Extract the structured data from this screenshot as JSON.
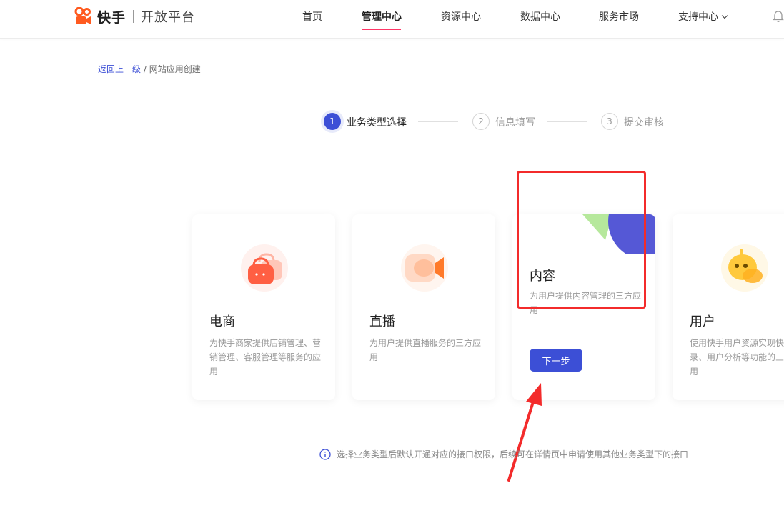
{
  "header": {
    "brand": "快手",
    "subtitle": "开放平台",
    "nav": [
      {
        "label": "首页",
        "active": false
      },
      {
        "label": "管理中心",
        "active": true
      },
      {
        "label": "资源中心",
        "active": false
      },
      {
        "label": "数据中心",
        "active": false
      },
      {
        "label": "服务市场",
        "active": false
      },
      {
        "label": "支持中心",
        "active": false
      }
    ]
  },
  "breadcrumb": {
    "back": "返回上一级",
    "separator": " / ",
    "current": "网站应用创建"
  },
  "steps": [
    {
      "number": "1",
      "label": "业务类型选择",
      "active": true
    },
    {
      "number": "2",
      "label": "信息填写",
      "active": false
    },
    {
      "number": "3",
      "label": "提交审核",
      "active": false
    }
  ],
  "cards": [
    {
      "title": "电商",
      "desc": "为快手商家提供店铺管理、营销管理、客服管理等服务的应用",
      "icon": "shopping-bag-icon"
    },
    {
      "title": "直播",
      "desc": "为用户提供直播服务的三方应用",
      "icon": "video-camera-icon"
    },
    {
      "title": "内容",
      "desc": "为用户提供内容管理的三方应用",
      "icon": "content-decoration",
      "button": "下一步"
    },
    {
      "title": "用户",
      "desc": "使用快手用户资源实现快捷登录、用户分析等功能的三方应用",
      "icon": "user-mascot-icon"
    }
  ],
  "tip": "选择业务类型后默认开通对应的接口权限，后续可在详情页中申请使用其他业务类型下的接口",
  "colors": {
    "primary": "#3c4fd6",
    "brand_orange": "#ff5a1f",
    "annotation_red": "#f32b2b",
    "nav_underline": "#fe3666"
  }
}
